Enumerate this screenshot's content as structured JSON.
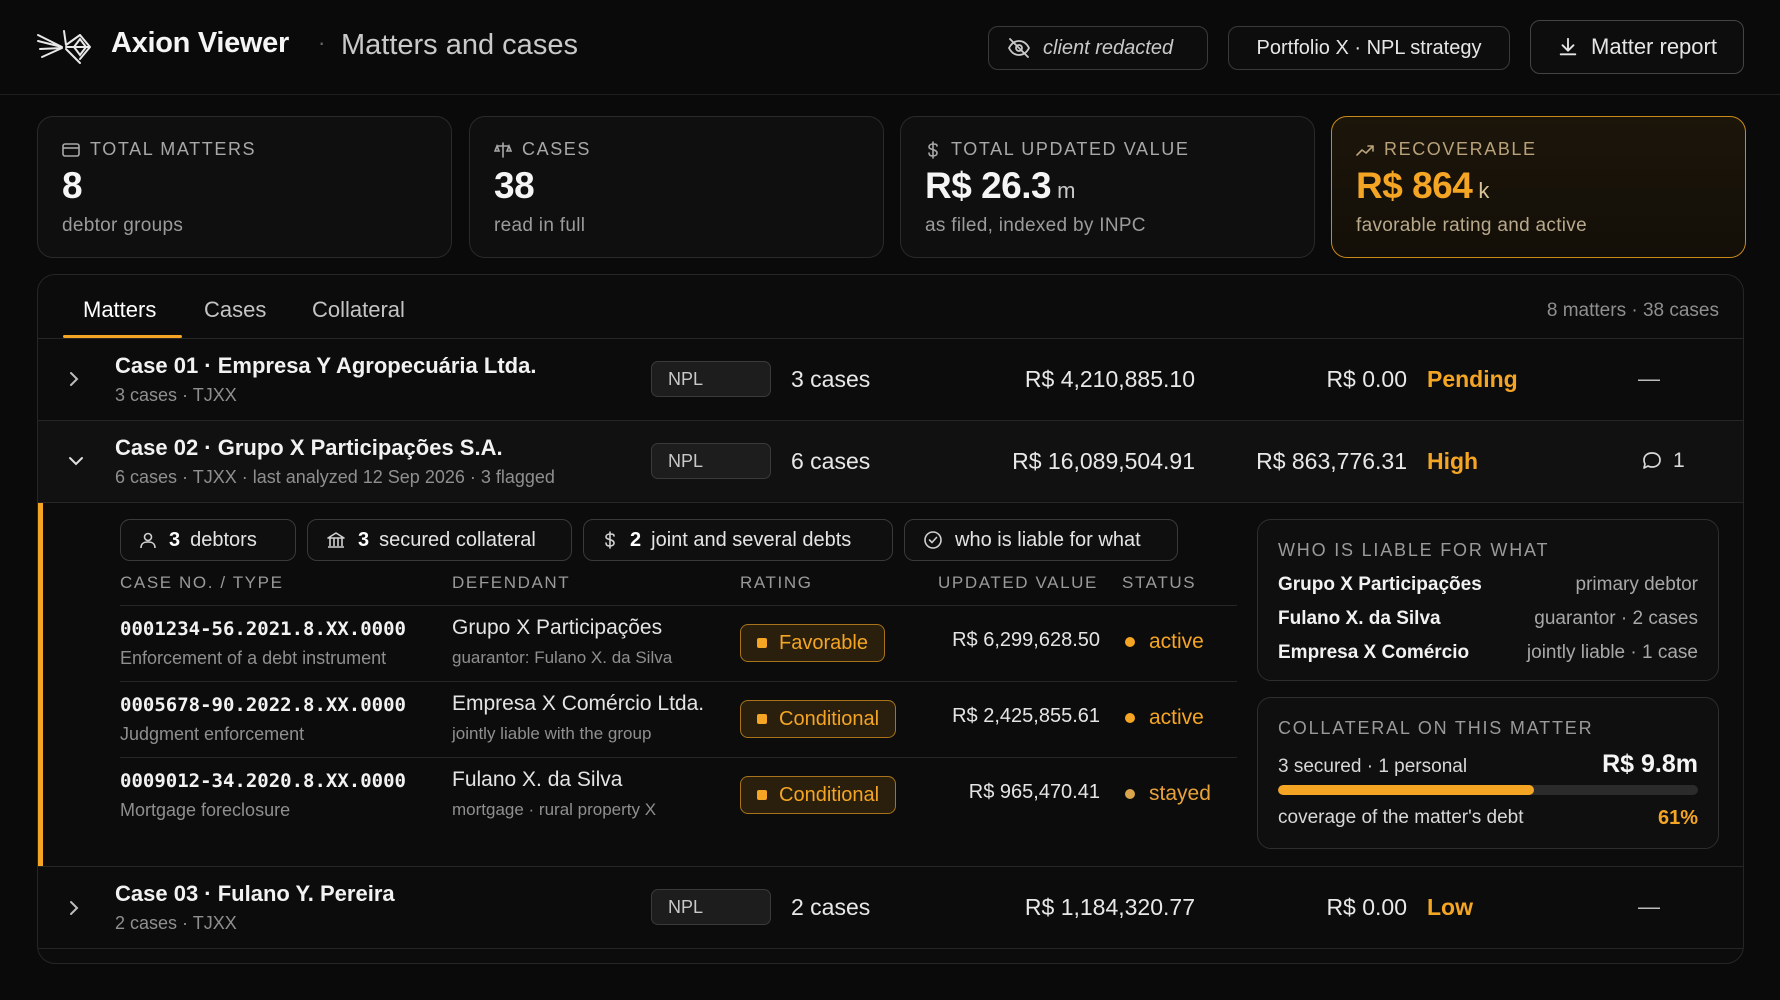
{
  "header": {
    "brand": "Axion Viewer",
    "separator": "·",
    "subtitle": "Matters and cases",
    "redacted_label": "client redacted",
    "portfolio_label": "Portfolio X · NPL strategy",
    "report_label": "Matter report"
  },
  "stats": [
    {
      "label": "TOTAL MATTERS",
      "value": "8",
      "unit": "",
      "sub": "debtor groups",
      "icon": "folder-icon"
    },
    {
      "label": "CASES",
      "value": "38",
      "unit": "",
      "sub": "read in full",
      "icon": "scale-icon"
    },
    {
      "label": "TOTAL UPDATED VALUE",
      "value": "R$ 26.3",
      "unit": "m",
      "sub": "as filed, indexed by INPC",
      "icon": "dollar-icon"
    },
    {
      "label": "RECOVERABLE",
      "value": "R$ 864",
      "unit": "k",
      "sub": "favorable rating and active",
      "icon": "trend-up-icon"
    }
  ],
  "tabs": {
    "items": [
      "Matters",
      "Cases",
      "Collateral"
    ],
    "active": "Matters",
    "meta": "8 matters · 38 cases"
  },
  "matters": [
    {
      "title": "Case 01 · Empresa Y Agropecuária Ltda.",
      "meta": "3 cases · TJXX",
      "tag": "NPL",
      "cases": "3 cases",
      "updated_value": "R$ 4,210,885.10",
      "recoverable": "R$ 0.00",
      "rating": "Pending",
      "comments": "—",
      "expanded": false
    },
    {
      "title": "Case 02 · Grupo X Participações S.A.",
      "meta": "6 cases · TJXX · last analyzed 12 Sep 2026 · 3 flagged",
      "tag": "NPL",
      "cases": "6 cases",
      "updated_value": "R$ 16,089,504.91",
      "recoverable": "R$ 863,776.31",
      "rating": "High",
      "comments": "1",
      "expanded": true
    },
    {
      "title": "Case 03 · Fulano Y. Pereira",
      "meta": "2 cases · TJXX",
      "tag": "NPL",
      "cases": "2 cases",
      "updated_value": "R$ 1,184,320.77",
      "recoverable": "R$ 0.00",
      "rating": "Low",
      "comments": "—",
      "expanded": false
    }
  ],
  "detail": {
    "chips": [
      {
        "count": "3",
        "label": "debtors",
        "icon": "person-icon"
      },
      {
        "count": "3",
        "label": "secured collateral",
        "icon": "bank-icon"
      },
      {
        "count": "2",
        "label": "joint and several debts",
        "icon": "dollar-icon"
      },
      {
        "count": "",
        "label": "who is liable for what",
        "icon": "check-circle-icon"
      }
    ],
    "columns": [
      "CASE NO. / TYPE",
      "DEFENDANT",
      "RATING",
      "UPDATED VALUE",
      "STATUS"
    ],
    "rows": [
      {
        "case_no": "0001234-56.2021.8.XX.0000",
        "type": "Enforcement of a debt instrument",
        "defendant": "Grupo X Participações",
        "defendant_sub": "guarantor: Fulano X. da Silva",
        "rating": "Favorable",
        "value": "R$ 6,299,628.50",
        "status": "active"
      },
      {
        "case_no": "0005678-90.2022.8.XX.0000",
        "type": "Judgment enforcement",
        "defendant": "Empresa X Comércio Ltda.",
        "defendant_sub": "jointly liable with the group",
        "rating": "Conditional",
        "value": "R$ 2,425,855.61",
        "status": "active"
      },
      {
        "case_no": "0009012-34.2020.8.XX.0000",
        "type": "Mortgage foreclosure",
        "defendant": "Fulano X. da Silva",
        "defendant_sub": "mortgage · rural property X",
        "rating": "Conditional",
        "value": "R$ 965,470.41",
        "status": "stayed"
      }
    ],
    "liability": {
      "heading": "WHO IS LIABLE FOR WHAT",
      "items": [
        {
          "who": "Grupo X Participações",
          "what": "primary debtor"
        },
        {
          "who": "Fulano X. da Silva",
          "what": "guarantor · 2 cases"
        },
        {
          "who": "Empresa X Comércio",
          "what": "jointly liable · 1 case"
        }
      ]
    },
    "collateral": {
      "heading": "COLLATERAL ON THIS MATTER",
      "summary": "3 secured · 1 personal",
      "amount": "R$ 9.8m",
      "coverage_label": "coverage of the matter's debt",
      "coverage": "61%",
      "coverage_fraction": 0.61
    }
  },
  "colors": {
    "accent": "#f5a524",
    "background": "#0a0a0a",
    "border": "#262626"
  }
}
